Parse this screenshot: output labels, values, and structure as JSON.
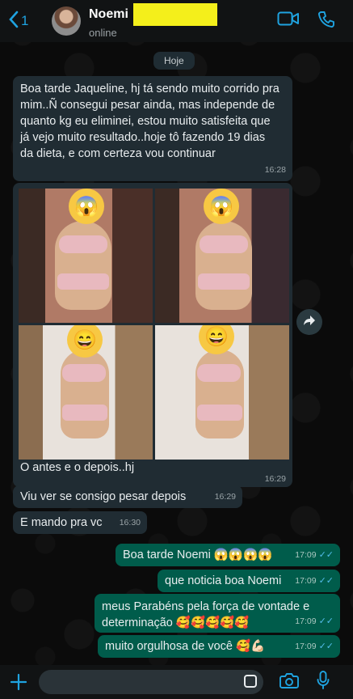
{
  "header": {
    "back_count": "1",
    "contact_name": "Noemi",
    "status": "online"
  },
  "chat": {
    "date_label": "Hoje",
    "incoming": [
      {
        "text": "Boa tarde Jaqueline, hj tá sendo muito corrido pra mim..Ñ consegui pesar ainda, mas independe de quanto kg eu eliminei, estou muito satisfeita que já vejo muito resultado..hoje tô fazendo 19 dias da dieta, e com certeza vou continuar",
        "time": "16:28"
      },
      {
        "text": "O antes e o depois..hj",
        "time": "16:29"
      },
      {
        "text": "Viu ver se consigo pesar depois",
        "time": "16:29"
      },
      {
        "text": "E mando pra vc",
        "time": "16:30"
      }
    ],
    "outgoing": [
      {
        "text": "Boa tarde Noemi 😱😱😱😱",
        "time": "17:09"
      },
      {
        "text": "que noticia boa Noemi",
        "time": "17:09"
      },
      {
        "text": "meus Parabéns pela força de vontade e determinação 🥰🥰🥰🥰🥰",
        "time": "17:09"
      },
      {
        "text": "muito orgulhosa de você 🥰💪🏻",
        "time": "17:09"
      }
    ],
    "read_ticks": "✓✓"
  },
  "colors": {
    "accent": "#1fa3e0",
    "incoming_bubble": "#202c33",
    "outgoing_bubble": "#005c4b",
    "redaction": "#f4ef1b"
  },
  "icons": {
    "back": "chevron-left-icon",
    "video": "video-call-icon",
    "phone": "phone-icon",
    "forward": "forward-icon",
    "plus": "plus-icon",
    "sticker": "sticker-icon",
    "camera": "camera-icon",
    "mic": "microphone-icon"
  }
}
